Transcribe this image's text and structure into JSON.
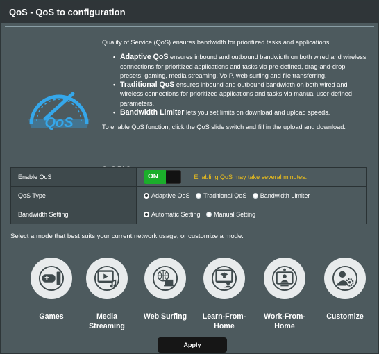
{
  "title": "QoS - QoS to configuration",
  "description": {
    "intro": "Quality of Service (QoS) ensures bandwidth for prioritized tasks and applications.",
    "bullets": [
      {
        "bold": "Adaptive QoS",
        "lines": [
          " ensures inbound and outbound bandwidth on both wired and wireless",
          "connections for prioritized applications and tasks via pre-defined, drag-and-drop",
          "presets: gaming, media streaming, VoIP, web surfing and file transferring."
        ]
      },
      {
        "bold": "Traditional QoS",
        "lines": [
          " ensures inbound and outbound bandwidth on both wired and",
          "wireless connections for prioritized applications and tasks via manual user-defined",
          "parameters."
        ]
      },
      {
        "bold": "Bandwidth Limiter",
        "lines": [
          " lets you set limits on download and upload speeds."
        ]
      }
    ],
    "instruction": "To enable QoS function, click the QoS slide switch and fill in the upload and download.",
    "faq_link": "QoS FAQ"
  },
  "logo_text": "QoS",
  "settings": {
    "enable": {
      "label": "Enable QoS",
      "toggle": "ON",
      "warning": "Enabling QoS may take several minutes."
    },
    "type": {
      "label": "QoS Type",
      "options": [
        "Adaptive QoS",
        "Traditional QoS",
        "Bandwidth Limiter"
      ],
      "selected": "Adaptive QoS"
    },
    "bandwidth": {
      "label": "Bandwidth Setting",
      "options": [
        "Automatic Setting",
        "Manual Setting"
      ],
      "selected": "Automatic Setting"
    }
  },
  "mode_prompt": "Select a mode that best suits your current network usage, or customize a mode.",
  "modes": [
    {
      "lines": [
        "Games"
      ],
      "icon": "gamepad-icon"
    },
    {
      "lines": [
        "Media",
        "Streaming"
      ],
      "icon": "media-streaming-icon"
    },
    {
      "lines": [
        "Web Surfing"
      ],
      "icon": "globe-laptop-icon"
    },
    {
      "lines": [
        "Learn-From-",
        "Home"
      ],
      "icon": "learn-from-home-icon"
    },
    {
      "lines": [
        "Work-From-",
        "Home"
      ],
      "icon": "work-from-home-icon"
    },
    {
      "lines": [
        "Customize"
      ],
      "icon": "user-gear-icon"
    }
  ],
  "apply_label": "Apply",
  "colors": {
    "toggle_on": "#1bae2b",
    "warning": "#f2c21a",
    "panel": "#4d5a5e",
    "titlebar": "#2f3538",
    "logo_accent": "#35a7ea"
  }
}
